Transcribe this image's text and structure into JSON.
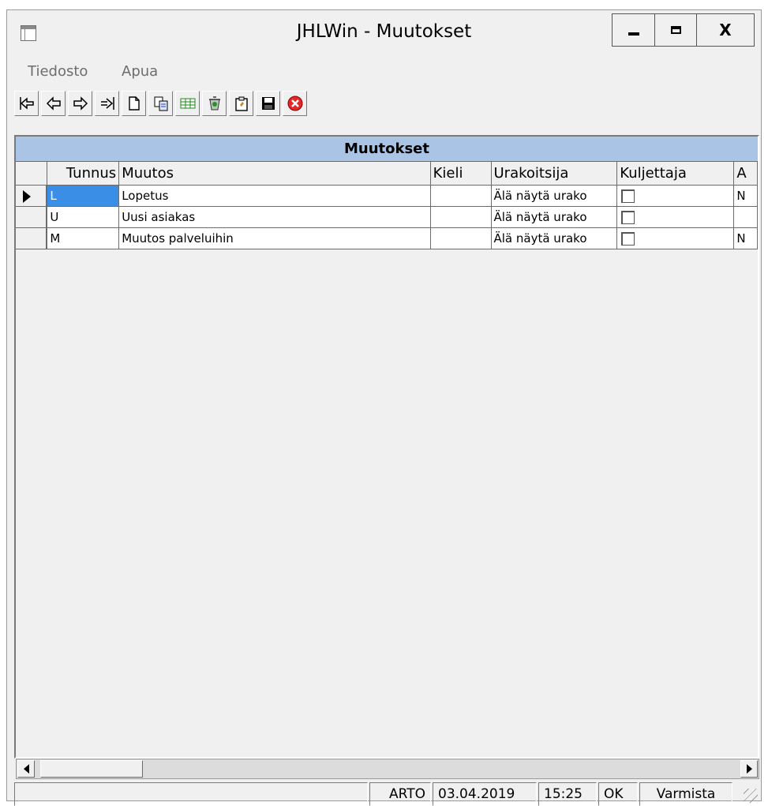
{
  "window": {
    "title": "JHLWin - Muutokset",
    "close_label": "X"
  },
  "menu": {
    "items": [
      "Tiedosto",
      "Apua"
    ]
  },
  "toolbar": {
    "buttons": [
      "first-record",
      "previous-record",
      "next-record",
      "last-record",
      "new-record",
      "copy-record",
      "table-view",
      "delete-record",
      "edit-record",
      "save-record",
      "close-form"
    ]
  },
  "grid": {
    "caption": "Muutokset",
    "columns": [
      "Tunnus",
      "Muutos",
      "Kieli",
      "Urakoitsija",
      "Kuljettaja",
      "A"
    ],
    "rows": [
      {
        "tunnus": "L",
        "muutos": "Lopetus",
        "kieli": "",
        "urakoitsija": "Älä näytä urako",
        "kuljettaja": false,
        "a": "N",
        "selected": true
      },
      {
        "tunnus": "U",
        "muutos": "Uusi asiakas",
        "kieli": "",
        "urakoitsija": "Älä näytä urako",
        "kuljettaja": false,
        "a": "",
        "selected": false
      },
      {
        "tunnus": "M",
        "muutos": "Muutos palveluihin",
        "kieli": "",
        "urakoitsija": "Älä näytä urako",
        "kuljettaja": false,
        "a": "N",
        "selected": false
      }
    ]
  },
  "status": {
    "message": "",
    "user": "ARTO",
    "date": "03.04.2019",
    "time": "15:25",
    "state": "OK",
    "backup_label": "Varmista"
  },
  "colors": {
    "caption_bg": "#a9c4e4",
    "selection": "#3a8ee6",
    "window_bg": "#f0f0f0"
  }
}
